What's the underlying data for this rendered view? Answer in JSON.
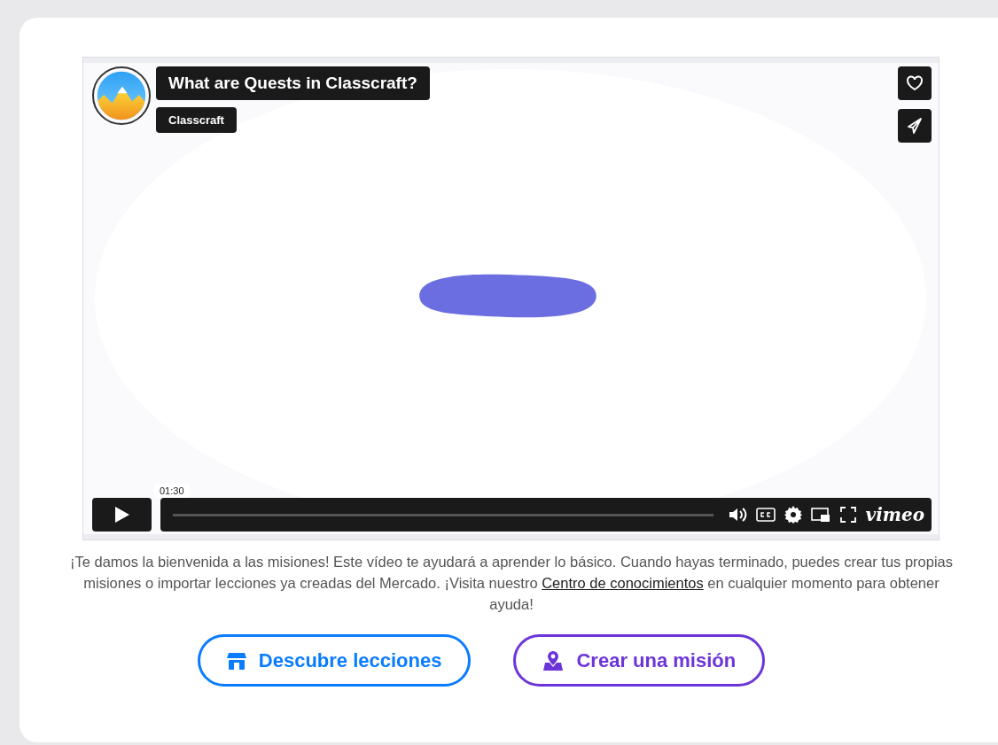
{
  "video": {
    "kind": "picture",
    "title": "What are Quests in Classcraft?",
    "channel": "Classcraft",
    "time_tooltip": "01:30",
    "logo": "vimeo"
  },
  "description": {
    "before": "¡Te damos la bienvenida a las misiones! Este vídeo te ayudará a aprender lo básico. Cuando hayas terminado, puedes crear tus propias misiones o importar lecciones ya creadas del Mercado. ¡Visita nuestro ",
    "link": "Centro de conocimientos",
    "after": " en cualquier momento para obtener ayuda!"
  },
  "buttons": [
    {
      "label": "Descubre lecciones",
      "kind": "store",
      "color": "#0a7cff"
    },
    {
      "label": "Crear una misión",
      "kind": "map",
      "color": "#6c35d9"
    }
  ]
}
